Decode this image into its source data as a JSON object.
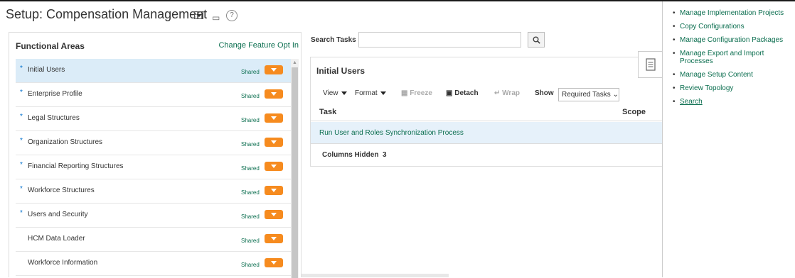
{
  "page": {
    "title": "Setup: Compensation Management",
    "help_glyph": "?"
  },
  "functional_areas": {
    "title": "Functional Areas",
    "change_feature_link": "Change Feature Opt In",
    "items": [
      {
        "label": "Initial Users",
        "required": true,
        "shared": "Shared",
        "selected": true
      },
      {
        "label": "Enterprise Profile",
        "required": true,
        "shared": "Shared",
        "selected": false
      },
      {
        "label": "Legal Structures",
        "required": true,
        "shared": "Shared",
        "selected": false
      },
      {
        "label": "Organization Structures",
        "required": true,
        "shared": "Shared",
        "selected": false
      },
      {
        "label": "Financial Reporting Structures",
        "required": true,
        "shared": "Shared",
        "selected": false
      },
      {
        "label": "Workforce Structures",
        "required": true,
        "shared": "Shared",
        "selected": false
      },
      {
        "label": "Users and Security",
        "required": true,
        "shared": "Shared",
        "selected": false
      },
      {
        "label": "HCM Data Loader",
        "required": false,
        "shared": "Shared",
        "selected": false
      },
      {
        "label": "Workforce Information",
        "required": false,
        "shared": "Shared",
        "selected": false
      }
    ],
    "required_marker": "*"
  },
  "search_tasks": {
    "label": "Search Tasks",
    "value": "",
    "placeholder": ""
  },
  "initial_users": {
    "title": "Initial Users",
    "toolbar": {
      "view": "View",
      "format": "Format",
      "freeze": "Freeze",
      "detach": "Detach",
      "wrap": "Wrap",
      "show_label": "Show",
      "show_value": "Required Tasks"
    },
    "columns": {
      "task": "Task",
      "scope": "Scope"
    },
    "tasks": [
      "Run User and Roles Synchronization Process"
    ],
    "columns_hidden_label": "Columns Hidden",
    "columns_hidden_count": "3"
  },
  "drawer": {
    "links": [
      "Manage Implementation Projects",
      "Copy Configurations",
      "Manage Configuration Packages",
      "Manage Export and Import Processes",
      "Manage Setup Content",
      "Review Topology",
      "Search"
    ]
  },
  "colors": {
    "accent_orange": "#f68b1f",
    "link_green": "#0b6e4f",
    "selection_blue": "#dbecf8",
    "highlight_yellow": "#ffff33"
  }
}
